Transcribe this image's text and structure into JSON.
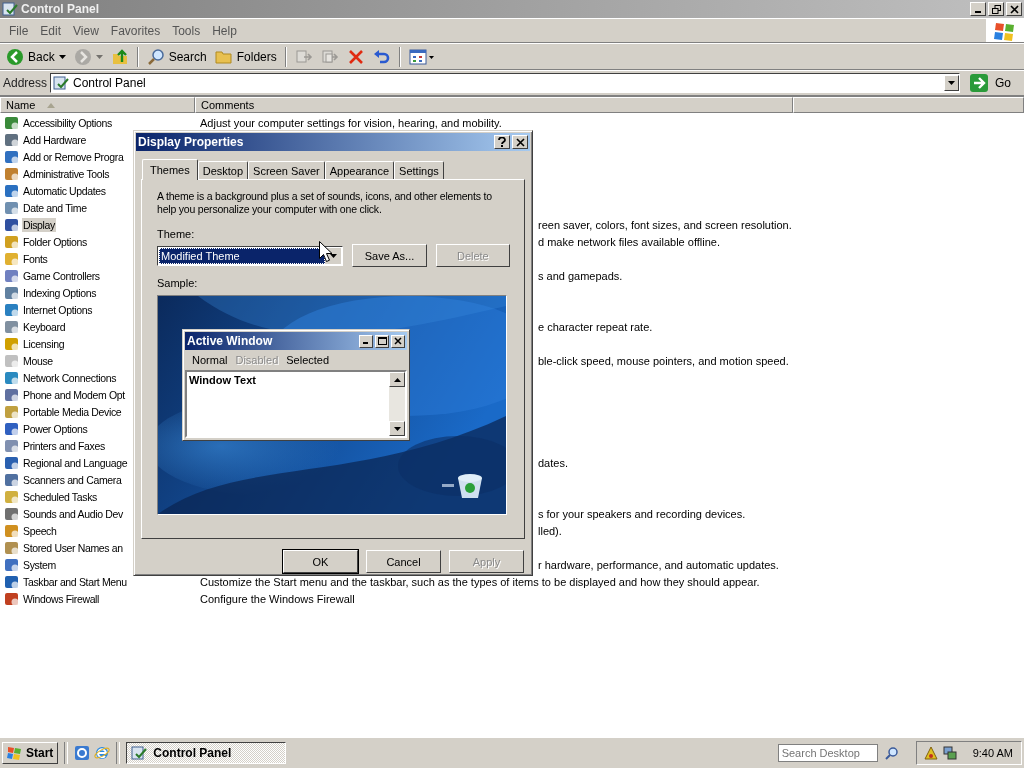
{
  "window": {
    "title": "Control Panel"
  },
  "menu": [
    "File",
    "Edit",
    "View",
    "Favorites",
    "Tools",
    "Help"
  ],
  "toolbar": [
    {
      "kind": "back",
      "label": "Back",
      "disabled": false
    },
    {
      "kind": "forward",
      "disabled": true
    },
    {
      "kind": "up",
      "disabled": false
    },
    {
      "kind": "search",
      "label": "Search",
      "disabled": false
    },
    {
      "kind": "folders",
      "label": "Folders",
      "disabled": false
    },
    {
      "kind": "move",
      "disabled": true
    },
    {
      "kind": "copy",
      "disabled": true
    },
    {
      "kind": "delete",
      "disabled": false
    },
    {
      "kind": "undo",
      "disabled": false
    },
    {
      "kind": "views",
      "disabled": false
    }
  ],
  "address": {
    "label": "Address",
    "value": "Control Panel",
    "go": "Go"
  },
  "columns": [
    {
      "label": "Name",
      "sorted": true
    },
    {
      "label": "Comments",
      "sorted": false
    }
  ],
  "items": [
    {
      "name": "Accessibility Options",
      "comment": "Adjust your computer settings for vision, hearing, and mobility.",
      "selected": false
    },
    {
      "name": "Add Hardware",
      "selected": false
    },
    {
      "name": "Add or Remove Progra",
      "selected": false
    },
    {
      "name": "Administrative Tools",
      "selected": false
    },
    {
      "name": "Automatic Updates",
      "selected": false
    },
    {
      "name": "Date and Time",
      "selected": false
    },
    {
      "name": "Display",
      "comment": "reen saver, colors, font sizes, and screen resolution.",
      "selected": true
    },
    {
      "name": "Folder Options",
      "comment": "d make network files available offline.",
      "selected": false
    },
    {
      "name": "Fonts",
      "selected": false
    },
    {
      "name": "Game Controllers",
      "comment": "s and gamepads.",
      "selected": false
    },
    {
      "name": "Indexing Options",
      "selected": false
    },
    {
      "name": "Internet Options",
      "selected": false
    },
    {
      "name": "Keyboard",
      "comment": "e character repeat rate.",
      "selected": false
    },
    {
      "name": "Licensing",
      "selected": false
    },
    {
      "name": "Mouse",
      "comment": "ble-click speed, mouse pointers, and motion speed.",
      "selected": false
    },
    {
      "name": "Network Connections",
      "selected": false
    },
    {
      "name": "Phone and Modem Opt",
      "selected": false
    },
    {
      "name": "Portable Media Device",
      "selected": false
    },
    {
      "name": "Power Options",
      "selected": false
    },
    {
      "name": "Printers and Faxes",
      "selected": false
    },
    {
      "name": "Regional and Language",
      "comment": "dates.",
      "selected": false
    },
    {
      "name": "Scanners and Camera",
      "selected": false
    },
    {
      "name": "Scheduled Tasks",
      "selected": false
    },
    {
      "name": "Sounds and Audio Dev",
      "comment": "s for your speakers and recording devices.",
      "selected": false
    },
    {
      "name": "Speech",
      "comment": "lled).",
      "selected": false
    },
    {
      "name": "Stored User Names an",
      "selected": false
    },
    {
      "name": "System",
      "comment": "r hardware, performance, and automatic updates.",
      "selected": false
    },
    {
      "name": "Taskbar and Start Menu",
      "comment": "Customize the Start menu and the taskbar, such as the types of items to be displayed and how they should appear.",
      "selected": false
    },
    {
      "name": "Windows Firewall",
      "comment": "Configure the Windows Firewall",
      "selected": false
    }
  ],
  "dialog": {
    "title": "Display Properties",
    "tabs": [
      {
        "label": "Themes",
        "selected": true
      },
      {
        "label": "Desktop",
        "selected": false
      },
      {
        "label": "Screen Saver",
        "selected": false
      },
      {
        "label": "Appearance",
        "selected": false
      },
      {
        "label": "Settings",
        "selected": false
      }
    ],
    "description": "A theme is a background plus a set of sounds, icons, and other elements to help you personalize your computer with one click.",
    "theme_label": "Theme:",
    "theme_value": "Modified Theme",
    "theme_buttons": [
      {
        "label": "Save As...",
        "disabled": false
      },
      {
        "label": "Delete",
        "disabled": true
      }
    ],
    "sample_label": "Sample:",
    "sample": {
      "window_title": "Active Window",
      "menu": [
        {
          "label": "Normal",
          "kind": "normal"
        },
        {
          "label": "Disabled",
          "kind": "disabled"
        },
        {
          "label": "Selected",
          "kind": "selected"
        }
      ],
      "text": "Window Text"
    },
    "buttons": [
      {
        "label": "OK",
        "disabled": false
      },
      {
        "label": "Cancel",
        "disabled": false
      },
      {
        "label": "Apply",
        "disabled": true
      }
    ]
  },
  "taskbar": {
    "start": "Start",
    "tasks": [
      {
        "label": "Control Panel",
        "selected": true
      }
    ],
    "search": {
      "placeholder": "Search Desktop"
    },
    "clock": "9:40 AM"
  }
}
